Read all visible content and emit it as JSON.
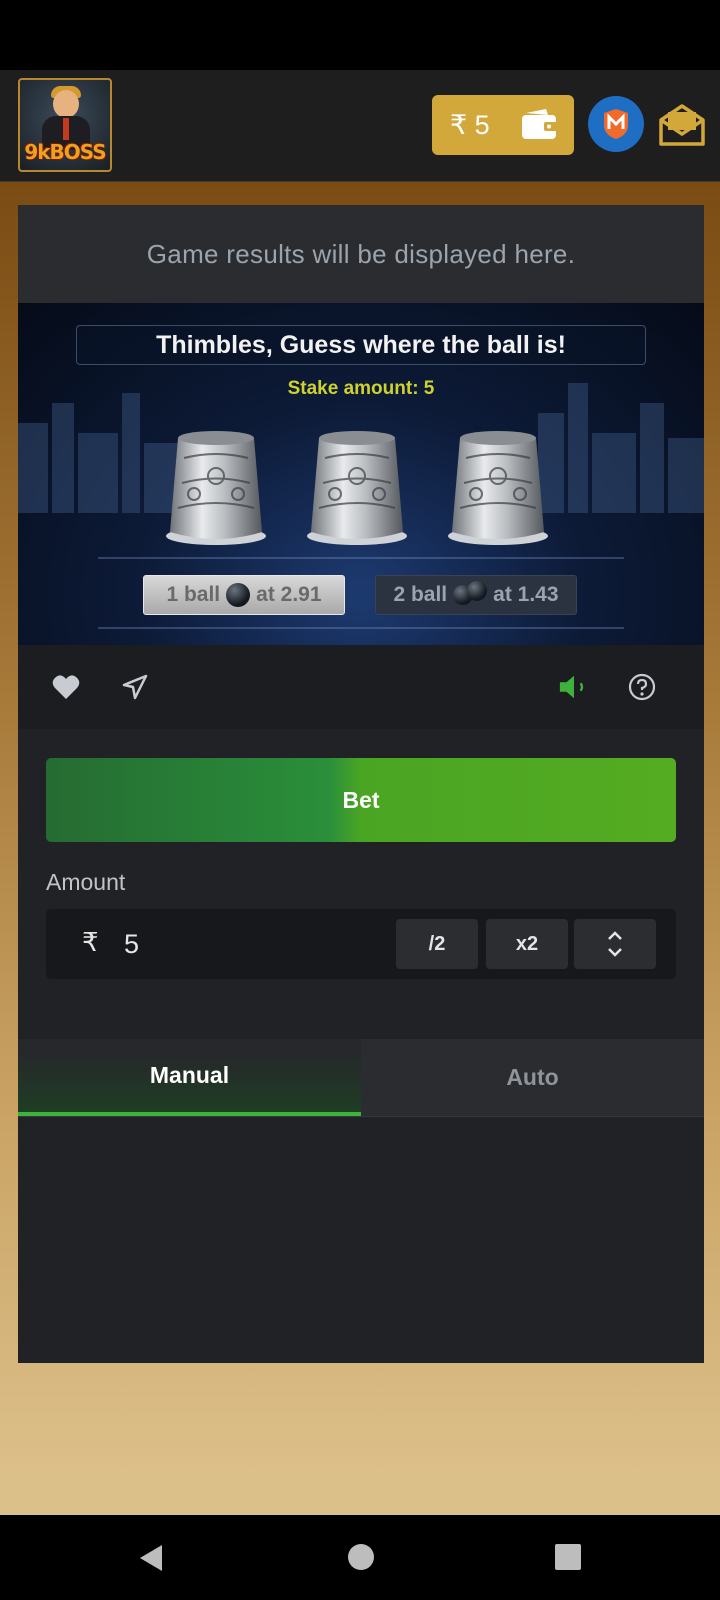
{
  "header": {
    "logo_text": "9kBOSS",
    "balance": "₹ 5",
    "icons": [
      "wallet-icon",
      "m-badge-icon",
      "mail-open-icon"
    ],
    "colors": {
      "balance_bg": "#d3a83b",
      "badge_bg": "#1e6fc4"
    }
  },
  "results": {
    "text": "Game results will be displayed here."
  },
  "game": {
    "title": "Thimbles, Guess where the ball is!",
    "stake": "Stake amount: 5",
    "options": [
      {
        "prefix": "1 ball",
        "suffix": "at 2.91"
      },
      {
        "prefix": "2 ball",
        "suffix": "at 1.43"
      }
    ]
  },
  "toolbar": {
    "icons": [
      "heart-icon",
      "send-icon",
      "volume-icon",
      "help-icon"
    ]
  },
  "controls": {
    "bet_label": "Bet",
    "amount_label": "Amount",
    "currency": "₹",
    "amount_value": "5",
    "half_label": "/2",
    "double_label": "x2",
    "accent": "#3eb33b"
  },
  "tabs": [
    {
      "label": "Manual",
      "active": true
    },
    {
      "label": "Auto",
      "active": false
    }
  ]
}
